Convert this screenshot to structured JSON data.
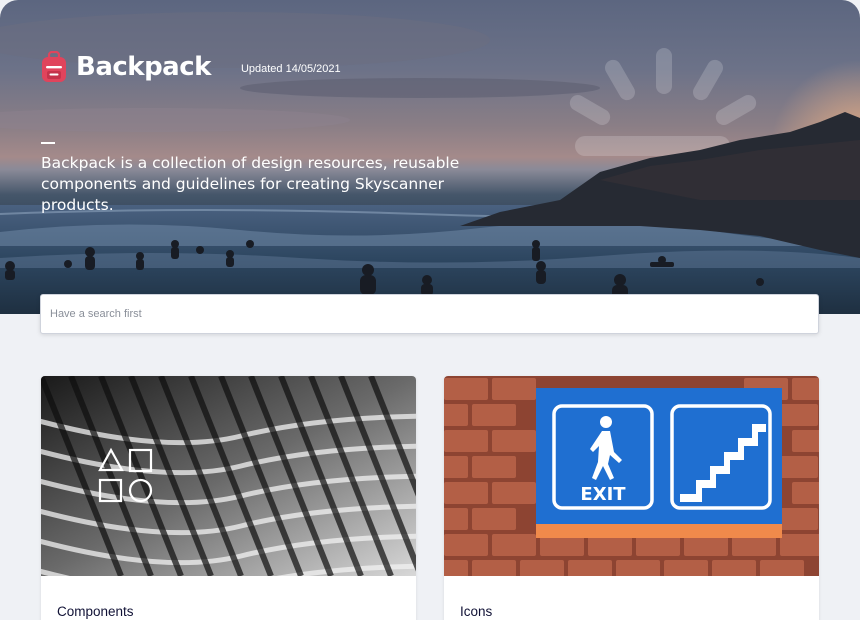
{
  "header": {
    "logo_text": "Backpack",
    "updated": "Updated 14/05/2021"
  },
  "hero": {
    "description": "Backpack is a collection of design resources, reusable components and guidelines for creating Skyscanner products."
  },
  "search": {
    "placeholder": "Have a search first"
  },
  "cards": [
    {
      "title": "Components",
      "icon": "shapes-icon"
    },
    {
      "title": "Icons",
      "icon": "exit-sign-image"
    }
  ],
  "colors": {
    "logo_accent": "#e0445c",
    "sign_blue": "#1f6fd1",
    "sign_orange": "#f08a4b",
    "brick": "#a4523a",
    "text_dark": "#111236"
  }
}
